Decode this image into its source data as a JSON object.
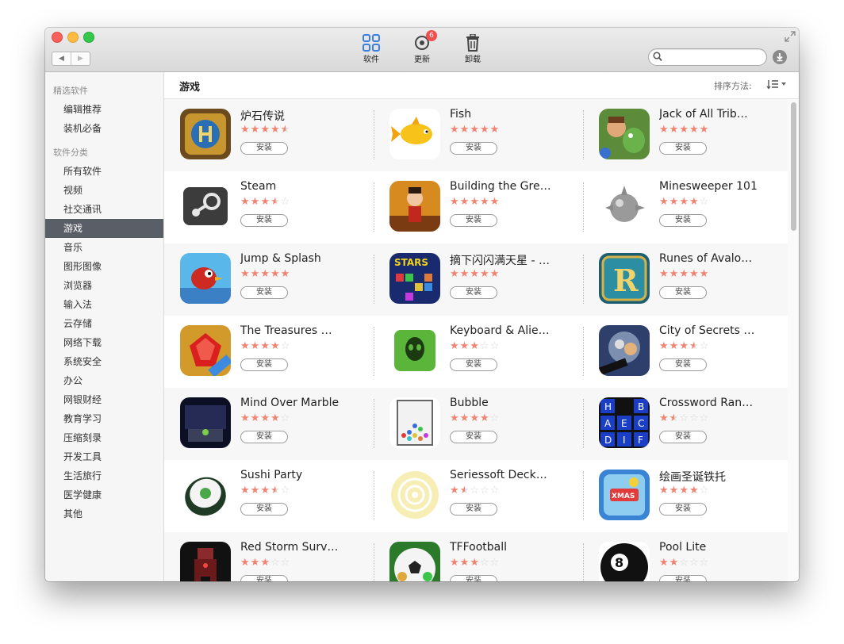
{
  "toolbar": {
    "apps_label": "软件",
    "update_label": "更新",
    "update_badge": "6",
    "uninstall_label": "卸载",
    "search_placeholder": ""
  },
  "sidebar": {
    "section1": "精选软件",
    "featured": [
      "编辑推荐",
      "装机必备"
    ],
    "section2": "软件分类",
    "categories": [
      "所有软件",
      "视频",
      "社交通讯",
      "游戏",
      "音乐",
      "图形图像",
      "浏览器",
      "输入法",
      "云存储",
      "网络下载",
      "系统安全",
      "办公",
      "网银财经",
      "教育学习",
      "压缩刻录",
      "开发工具",
      "生活旅行",
      "医学健康",
      "其他"
    ],
    "active_index": 3
  },
  "content": {
    "title": "游戏",
    "sort_label": "排序方法:"
  },
  "install_label": "安装",
  "apps": [
    [
      {
        "name": "炉石传说",
        "rating": 4.5,
        "icon": "hearthstone-icon"
      },
      {
        "name": "Fish",
        "rating": 5,
        "icon": "fish-icon"
      },
      {
        "name": "Jack of All Trib…",
        "rating": 5,
        "icon": "jack-of-all-tribes-icon"
      }
    ],
    [
      {
        "name": "Steam",
        "rating": 3.5,
        "icon": "steam-icon"
      },
      {
        "name": "Building the Gre…",
        "rating": 5,
        "icon": "building-the-great-wall-icon"
      },
      {
        "name": "Minesweeper 101",
        "rating": 4,
        "icon": "minesweeper-icon"
      }
    ],
    [
      {
        "name": "Jump & Splash",
        "rating": 5,
        "icon": "jump-splash-icon"
      },
      {
        "name": "摘下闪闪满天星 - …",
        "rating": 5,
        "icon": "stars-icon"
      },
      {
        "name": "Runes of Avalo…",
        "rating": 5,
        "icon": "runes-of-avalon-icon"
      }
    ],
    [
      {
        "name": "The Treasures …",
        "rating": 4,
        "icon": "treasures-icon"
      },
      {
        "name": "Keyboard & Alie…",
        "rating": 3,
        "icon": "keyboard-alien-icon"
      },
      {
        "name": "City of Secrets …",
        "rating": 3.5,
        "icon": "city-of-secrets-icon"
      }
    ],
    [
      {
        "name": "Mind Over Marble",
        "rating": 4,
        "icon": "mind-over-marble-icon"
      },
      {
        "name": "Bubble",
        "rating": 4,
        "icon": "bubble-icon"
      },
      {
        "name": "Crossword Ran…",
        "rating": 1.5,
        "icon": "crossword-icon"
      }
    ],
    [
      {
        "name": "Sushi Party",
        "rating": 3.5,
        "icon": "sushi-icon"
      },
      {
        "name": "Seriessoft Deck…",
        "rating": 1.5,
        "icon": "seriessoft-deck-icon"
      },
      {
        "name": "绘画圣诞铁托",
        "rating": 4,
        "icon": "christmas-painting-icon"
      }
    ],
    [
      {
        "name": "Red Storm Surv…",
        "rating": 3,
        "icon": "red-storm-icon"
      },
      {
        "name": "TFFootball",
        "rating": 3,
        "icon": "football-icon"
      },
      {
        "name": "Pool Lite",
        "rating": 2,
        "icon": "pool-icon"
      }
    ]
  ],
  "colors": {
    "star": "#f08472",
    "sidebar_active": "#5a5e66",
    "accent": "#3a7ee0"
  }
}
